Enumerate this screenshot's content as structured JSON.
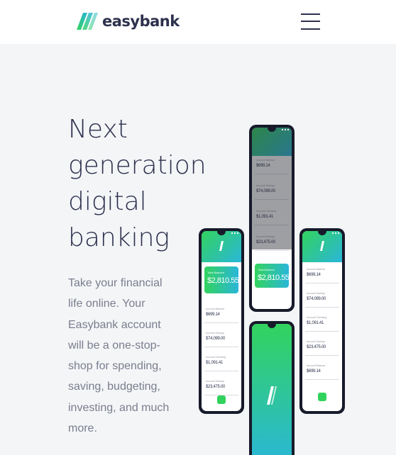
{
  "brand": {
    "name": "easybank"
  },
  "nav": {
    "menu_icon": "hamburger-icon"
  },
  "hero": {
    "headline": "Next generation digital banking",
    "description": "Take your financial life online. Your Easybank account will be a one-stop-shop for spending, saving, budgeting, investing, and much more."
  },
  "colors": {
    "primary": "#2d314d",
    "green": "#31d35c",
    "cyan": "#2bb7da",
    "text_gray": "#9698a6",
    "background": "#f4f5f7"
  },
  "phones": {
    "center_top": {
      "rows": [
        {
          "label": "Account Balance",
          "value": "$699.14"
        },
        {
          "label": "Account Savings",
          "value": "$74,099.00"
        },
        {
          "label": "Account Checking",
          "value": "$1,091.41"
        },
        {
          "label": "Account Savings",
          "value": "$23,475.00"
        }
      ],
      "card": {
        "label": "Total Balance",
        "value": "$2,810.55"
      }
    },
    "left": {
      "card": {
        "label": "Total Balance",
        "value": "$2,810.55"
      },
      "rows": [
        {
          "label": "Account Balance",
          "value": "$699.14"
        },
        {
          "label": "Account Savings",
          "value": "$74,099.00"
        },
        {
          "label": "Account Checking",
          "value": "$1,091.41"
        },
        {
          "label": "Account Savings",
          "value": "$23,475.00"
        }
      ]
    },
    "right": {
      "rows": [
        {
          "label": "Account Balance",
          "value": "$699.14"
        },
        {
          "label": "Account Savings",
          "value": "$74,099.00"
        },
        {
          "label": "Account Checking",
          "value": "$1,091.41"
        },
        {
          "label": "Account Savings",
          "value": "$23,475.00"
        },
        {
          "label": "Account Balance",
          "value": "$699.14"
        }
      ]
    }
  }
}
